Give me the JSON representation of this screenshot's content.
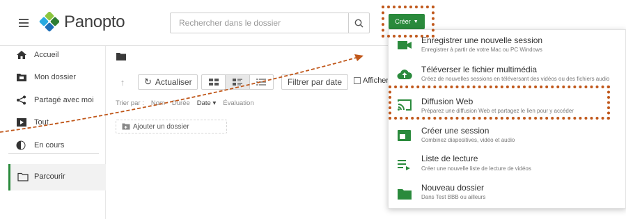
{
  "header": {
    "brand": "Panopto",
    "search_placeholder": "Rechercher dans le dossier",
    "create_label": "Créer"
  },
  "sidebar": {
    "items": [
      {
        "label": "Accueil",
        "icon": "home-icon"
      },
      {
        "label": "Mon dossier",
        "icon": "folder-icon"
      },
      {
        "label": "Partagé avec moi",
        "icon": "share-icon"
      },
      {
        "label": "Tout",
        "icon": "video-list-icon"
      },
      {
        "label": "En cours",
        "icon": "in-progress-icon"
      }
    ],
    "browse_label": "Parcourir"
  },
  "toolbar": {
    "refresh_label": "Actualiser",
    "filter_label": "Filtrer par date",
    "show_label": "Afficher"
  },
  "sort": {
    "prefix": "Trier par :",
    "name": "Nom",
    "duration": "Durée",
    "date": "Date ▾",
    "rating": "Évaluation"
  },
  "add_folder_label": "Ajouter un dossier",
  "menu": {
    "items": [
      {
        "title": "Enregistrer une nouvelle session",
        "subtitle": "Enregistrer à partir de votre Mac ou PC Windows",
        "icon": "camera-icon"
      },
      {
        "title": "Téléverser le fichier multimédia",
        "subtitle": "Créez de nouvelles sessions en téléversant des vidéos ou des fichiers audio",
        "icon": "upload-cloud-icon"
      },
      {
        "title": "Diffusion Web",
        "subtitle": "Préparez une diffusion Web et partagez le lien pour y accéder",
        "icon": "cast-icon"
      },
      {
        "title": "Créer une session",
        "subtitle": "Combinez diapositives, vidéo et audio",
        "icon": "session-icon"
      },
      {
        "title": "Liste de lecture",
        "subtitle": "Créer une nouvelle liste de lecture de vidéos",
        "icon": "playlist-icon"
      },
      {
        "title": "Nouveau dossier",
        "subtitle": "Dans Test BBB ou ailleurs",
        "icon": "new-folder-icon"
      }
    ]
  },
  "colors": {
    "accent": "#2a8a3c",
    "annotation": "#c0571a"
  }
}
